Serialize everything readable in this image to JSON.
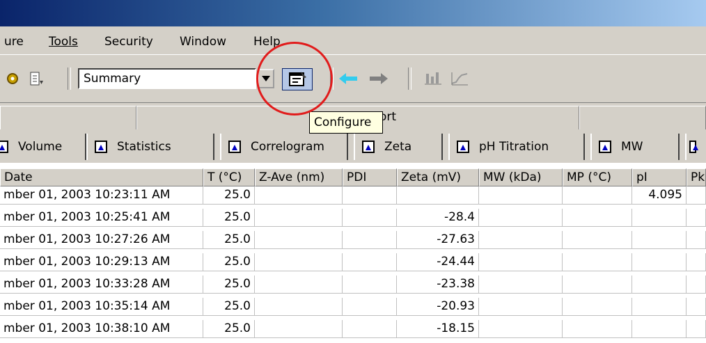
{
  "menu": {
    "items": [
      "ure",
      "Tools",
      "Security",
      "Window",
      "Help"
    ]
  },
  "toolbar": {
    "view_select_value": "Summary",
    "icons": [
      "gear-icon",
      "sort-icon",
      "dropdown-arrow-icon",
      "configure-icon",
      "back-arrow-icon",
      "forward-arrow-icon",
      "mw-icon",
      "ph-icon"
    ]
  },
  "tabs_top": {
    "partial_label": "ort"
  },
  "tooltip": {
    "text": "Configure"
  },
  "tabs": [
    "Volume",
    "Statistics",
    "Correlogram",
    "Zeta",
    "pH Titration",
    "MW"
  ],
  "table": {
    "columns": [
      "Date",
      "T (°C)",
      "Z-Ave (nm)",
      "PDI",
      "Zeta (mV)",
      "MW (kDa)",
      "MP (°C)",
      "pI",
      "Pk"
    ],
    "rows": [
      [
        "mber 01, 2003 10:23:11 AM",
        "25.0",
        "",
        "",
        "",
        "",
        "",
        "4.095",
        ""
      ],
      [
        "mber 01, 2003 10:25:41 AM",
        "25.0",
        "",
        "",
        "-28.4",
        "",
        "",
        "",
        ""
      ],
      [
        "mber 01, 2003 10:27:26 AM",
        "25.0",
        "",
        "",
        "-27.63",
        "",
        "",
        "",
        ""
      ],
      [
        "mber 01, 2003 10:29:13 AM",
        "25.0",
        "",
        "",
        "-24.44",
        "",
        "",
        "",
        ""
      ],
      [
        "mber 01, 2003 10:33:28 AM",
        "25.0",
        "",
        "",
        "-23.38",
        "",
        "",
        "",
        ""
      ],
      [
        "mber 01, 2003 10:35:14 AM",
        "25.0",
        "",
        "",
        "-20.93",
        "",
        "",
        "",
        ""
      ],
      [
        "mber 01, 2003 10:38:10 AM",
        "25.0",
        "",
        "",
        "-18.15",
        "",
        "",
        "",
        ""
      ]
    ]
  },
  "colors": {
    "annotation_circle": "#e11b1b",
    "tooltip_bg": "#ffffe1",
    "chrome": "#d4d0c8"
  }
}
